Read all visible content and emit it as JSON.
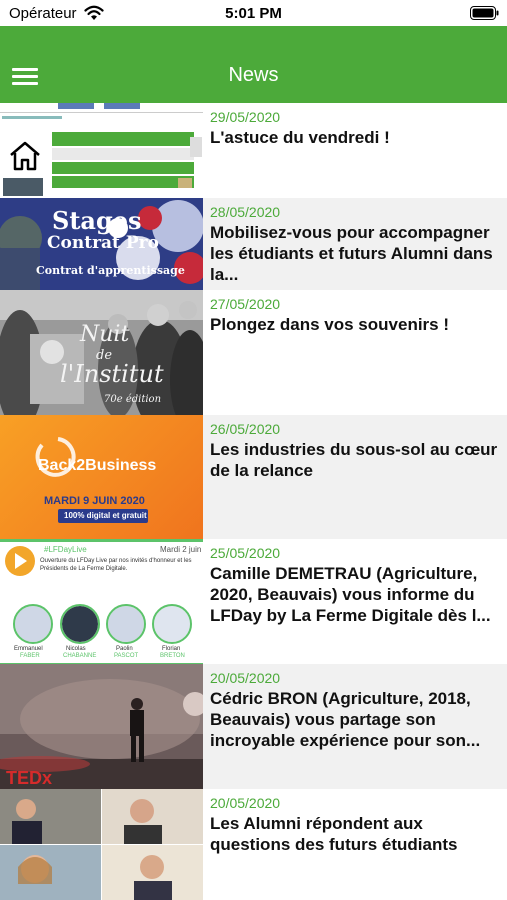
{
  "status_bar": {
    "carrier": "Opérateur",
    "time": "5:01 PM"
  },
  "app_bar": {
    "title": "News"
  },
  "news": [
    {
      "date": "29/05/2020",
      "title": "L'astuce du vendredi !",
      "thumb_icon": "home-icon"
    },
    {
      "date": "28/05/2020",
      "title": "Mobilisez-vous pour accompagner les étudiants et futurs Alumni dans la...",
      "thumb_text": [
        "Stages",
        "Contrat Pro",
        "Contrat d'apprentissage"
      ]
    },
    {
      "date": "27/05/2020",
      "title": "Plongez dans vos souvenirs !",
      "thumb_text": [
        "Nuit",
        "de",
        "l'Institut",
        "70e édition"
      ]
    },
    {
      "date": "26/05/2020",
      "title": "Les industries du sous-sol au cœur de la relance",
      "thumb_text": [
        "Back2Business",
        "MARDI 9 JUIN 2020",
        "100% digital et gratuit"
      ]
    },
    {
      "date": "25/05/2020",
      "title": "Camille DEMETRAU (Agriculture, 2020, Beauvais) vous informe du LFDay by La Ferme Digitale dès l...",
      "thumb_text": [
        "#LFDayLive",
        "Mardi 2 juin",
        "Ouverture du LFDay Live par nos invités d'honneur et les Présidents de La Ferme Digitale.",
        "Emmanuel",
        "FABER",
        "Nicolas",
        "CHABANNE",
        "Paolin",
        "PASCOT",
        "Florian",
        "BRETON"
      ]
    },
    {
      "date": "20/05/2020",
      "title": "Cédric BRON (Agriculture, 2018, Beauvais) vous partage son incroyable expérience pour son...",
      "thumb_text": [
        "TEDx"
      ]
    },
    {
      "date": "20/05/2020",
      "title": "Les Alumni répondent aux questions des futurs étudiants"
    }
  ],
  "colors": {
    "brand_green": "#4caa3a",
    "row_alt": "#f1f1f1"
  }
}
